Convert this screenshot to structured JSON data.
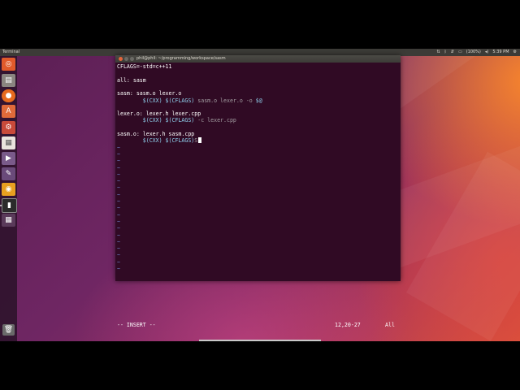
{
  "panel": {
    "app_title": "Terminal",
    "battery": "(100%)",
    "time": "5:39 PM"
  },
  "launcher": {
    "items": [
      {
        "name": "dash-home-icon"
      },
      {
        "name": "files-icon"
      },
      {
        "name": "firefox-icon"
      },
      {
        "name": "software-center-icon"
      },
      {
        "name": "system-settings-icon"
      },
      {
        "name": "libreoffice-impress-icon"
      },
      {
        "name": "pitivi-icon"
      },
      {
        "name": "tool-icon"
      },
      {
        "name": "ubuntu-one-icon"
      },
      {
        "name": "terminal-icon"
      },
      {
        "name": "workspace-switcher-icon"
      },
      {
        "name": "trash-icon"
      }
    ]
  },
  "terminal": {
    "title": "phil@phil: ~/programming/workspace/sasm",
    "lines": [
      [
        {
          "t": "CFLAGS=-std=c++11",
          "c": "plain"
        }
      ],
      [
        {
          "t": "",
          "c": "plain"
        }
      ],
      [
        {
          "t": "all: sasm",
          "c": "plain"
        }
      ],
      [
        {
          "t": "",
          "c": "plain"
        }
      ],
      [
        {
          "t": "sasm: sasm.o lexer.o",
          "c": "plain"
        }
      ],
      [
        {
          "t": "        ",
          "c": "plain"
        },
        {
          "t": "$(CXX) $(CFLAGS)",
          "c": "mac"
        },
        {
          "t": " sasm.o lexer.o -o ",
          "c": "gray"
        },
        {
          "t": "$@",
          "c": "mac"
        }
      ],
      [
        {
          "t": "",
          "c": "plain"
        }
      ],
      [
        {
          "t": "lexer.o: lexer.h lexer.cpp",
          "c": "plain"
        }
      ],
      [
        {
          "t": "        ",
          "c": "plain"
        },
        {
          "t": "$(CXX) $(CFLAGS)",
          "c": "mac"
        },
        {
          "t": " -c lexer.cpp",
          "c": "gray"
        }
      ],
      [
        {
          "t": "",
          "c": "plain"
        }
      ],
      [
        {
          "t": "sasm.o: lexer.h sasm.cpp",
          "c": "plain"
        }
      ],
      [
        {
          "t": "        ",
          "c": "plain"
        },
        {
          "t": "$(CXX) $(CFLAGS)",
          "c": "mac"
        },
        {
          "t": "S",
          "c": "gray"
        }
      ]
    ],
    "tilde_rows": 19,
    "tilde_char": "~",
    "status": {
      "mode": "-- INSERT --",
      "position": "12,20-27",
      "scroll": "All"
    }
  },
  "colors": {
    "background": "#300a24",
    "macro": "#8fd1ee",
    "dim": "#a39ea2",
    "tilde": "#6e7fc9"
  }
}
